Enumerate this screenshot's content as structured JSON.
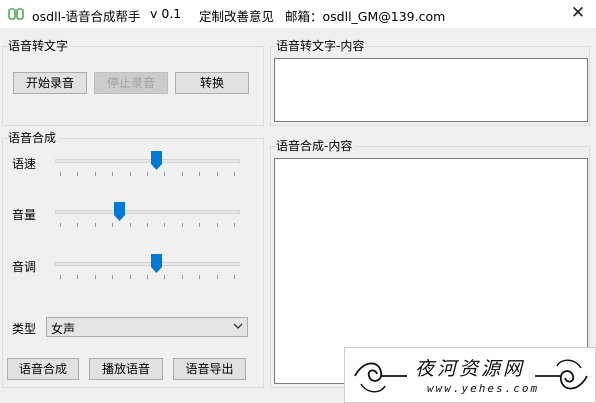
{
  "titlebar": {
    "app_name": "osdll-语音合成帮手",
    "version": "v 0.1",
    "feedback": "定制改善意见",
    "mail": "邮箱：osdll_GM@139.com",
    "close": "✕"
  },
  "stt": {
    "group_title": "语音转文字",
    "start_record": "开始录音",
    "stop_record": "停止录音",
    "convert": "转换",
    "content_title": "语音转文字-内容",
    "content_value": ""
  },
  "tts": {
    "group_title": "语音合成",
    "sliders": [
      {
        "label": "语速",
        "value": 0.55
      },
      {
        "label": "音量",
        "value": 0.34
      },
      {
        "label": "音调",
        "value": 0.55
      }
    ],
    "type_label": "类型",
    "type_value": "女声",
    "synthesize": "语音合成",
    "play": "播放语音",
    "export": "语音导出",
    "content_title": "语音合成-内容",
    "content_value": ""
  },
  "watermark": {
    "name": "夜河资源网",
    "url": "www.yehes.com"
  },
  "colors": {
    "accent": "#0078d7",
    "window_bg": "#f0f0f0"
  }
}
